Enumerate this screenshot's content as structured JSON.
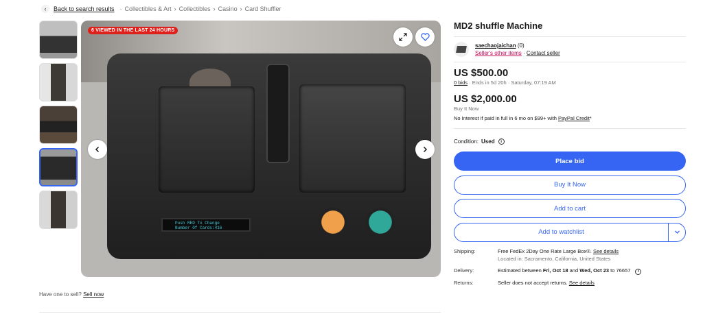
{
  "breadcrumbs": {
    "back": "Back to search results",
    "items": [
      "Collectibles & Art",
      "Collectibles",
      "Casino",
      "Card Shuffler"
    ]
  },
  "gallery": {
    "badge": "6 VIEWED IN THE LAST 24 HOURS",
    "lcd_line1": "Push RED To Change",
    "lcd_line2": "Number Of Cards:416",
    "thumbnail_count": 5,
    "selected_thumbnail": 4
  },
  "sell": {
    "text": "Have one to sell?",
    "link": "Sell now"
  },
  "item": {
    "title": "MD2 shuffle Machine",
    "seller_name": "saechaojaichan",
    "seller_score": "(0)",
    "seller_other": "Seller's other items",
    "contact": "Contact seller",
    "bid_price": "US $500.00",
    "bids_link": "0 bids",
    "ends": "· Ends in 5d 20h · Saturday, 07:19 AM",
    "bin_price": "US $2,000.00",
    "bin_label": "Buy It Now",
    "credit_text": "No Interest if paid in full in 6 mo on $99+ with",
    "credit_link": "PayPal Credit",
    "credit_suffix": "*",
    "condition_label": "Condition:",
    "condition_value": "Used"
  },
  "buttons": {
    "place_bid": "Place bid",
    "buy_now": "Buy It Now",
    "add_cart": "Add to cart",
    "watchlist": "Add to watchlist"
  },
  "details": {
    "shipping_label": "Shipping:",
    "shipping_text": "Free FedEx 2Day One Rate Large Box®.",
    "shipping_link": "See details",
    "location": "Located in: Sacramento, California, United States",
    "delivery_label": "Delivery:",
    "delivery_pre": "Estimated between",
    "delivery_from": "Fri, Oct 18",
    "delivery_and": "and",
    "delivery_to": "Wed, Oct 23",
    "delivery_post": "to 76657",
    "returns_label": "Returns:",
    "returns_text": "Seller does not accept returns.",
    "returns_link": "See details"
  },
  "colors": {
    "accent": "#3665f3",
    "badge": "#e0201b",
    "seller_link": "#c6055a"
  }
}
